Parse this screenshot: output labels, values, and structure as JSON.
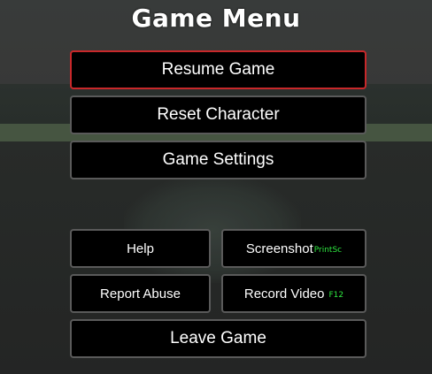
{
  "menu": {
    "title": "Game Menu",
    "resume_label": "Resume Game",
    "reset_label": "Reset Character",
    "settings_label": "Game Settings",
    "help_label": "Help",
    "screenshot_label": "Screenshot",
    "screenshot_hotkey": "PrintSc",
    "report_label": "Report Abuse",
    "record_label": "Record Video",
    "record_hotkey": "F12",
    "leave_label": "Leave Game"
  },
  "colors": {
    "button_bg": "#000000",
    "button_border": "#5a5a5a",
    "selected_border": "#c8282a",
    "hotkey_text": "#2ee840"
  }
}
